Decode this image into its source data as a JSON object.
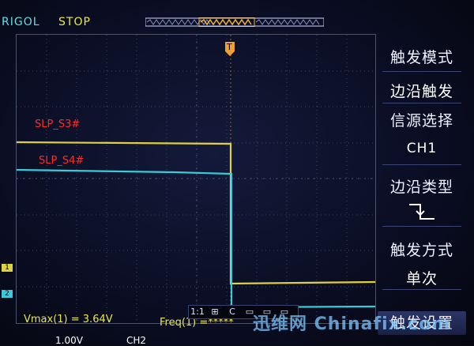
{
  "header": {
    "brand": "RIGOL",
    "run_state": "STOP"
  },
  "trigger_marker": "T",
  "menu": {
    "title": "触发模式",
    "items": [
      {
        "label": "边沿触发"
      },
      {
        "label": "信源选择"
      },
      {
        "label": "CH1"
      },
      {
        "label": "边沿类型"
      },
      {
        "label": "触发方式"
      },
      {
        "label": "单次"
      },
      {
        "label": "触发设置"
      }
    ]
  },
  "traces": {
    "ch1_label": "SLP_S3#",
    "ch2_label": "SLP_S4#",
    "ch1_marker": "1",
    "ch2_marker": "2"
  },
  "measurements": {
    "vmax": "Vmax(1) = 3.64V",
    "freq": "Freq(1) =*****"
  },
  "bottom": {
    "ch1_scale": "1.00V",
    "ch2_scale": "CH2"
  },
  "status_icons": [
    "1:1",
    "⊞",
    "C",
    "▭",
    "▭",
    "▭"
  ],
  "watermark": "迅维网 Chinafix.com",
  "colors": {
    "ch1": "#e0d040",
    "ch2": "#39c9d8",
    "label": "#ff2a2a",
    "brand": "#5ee0e6"
  }
}
